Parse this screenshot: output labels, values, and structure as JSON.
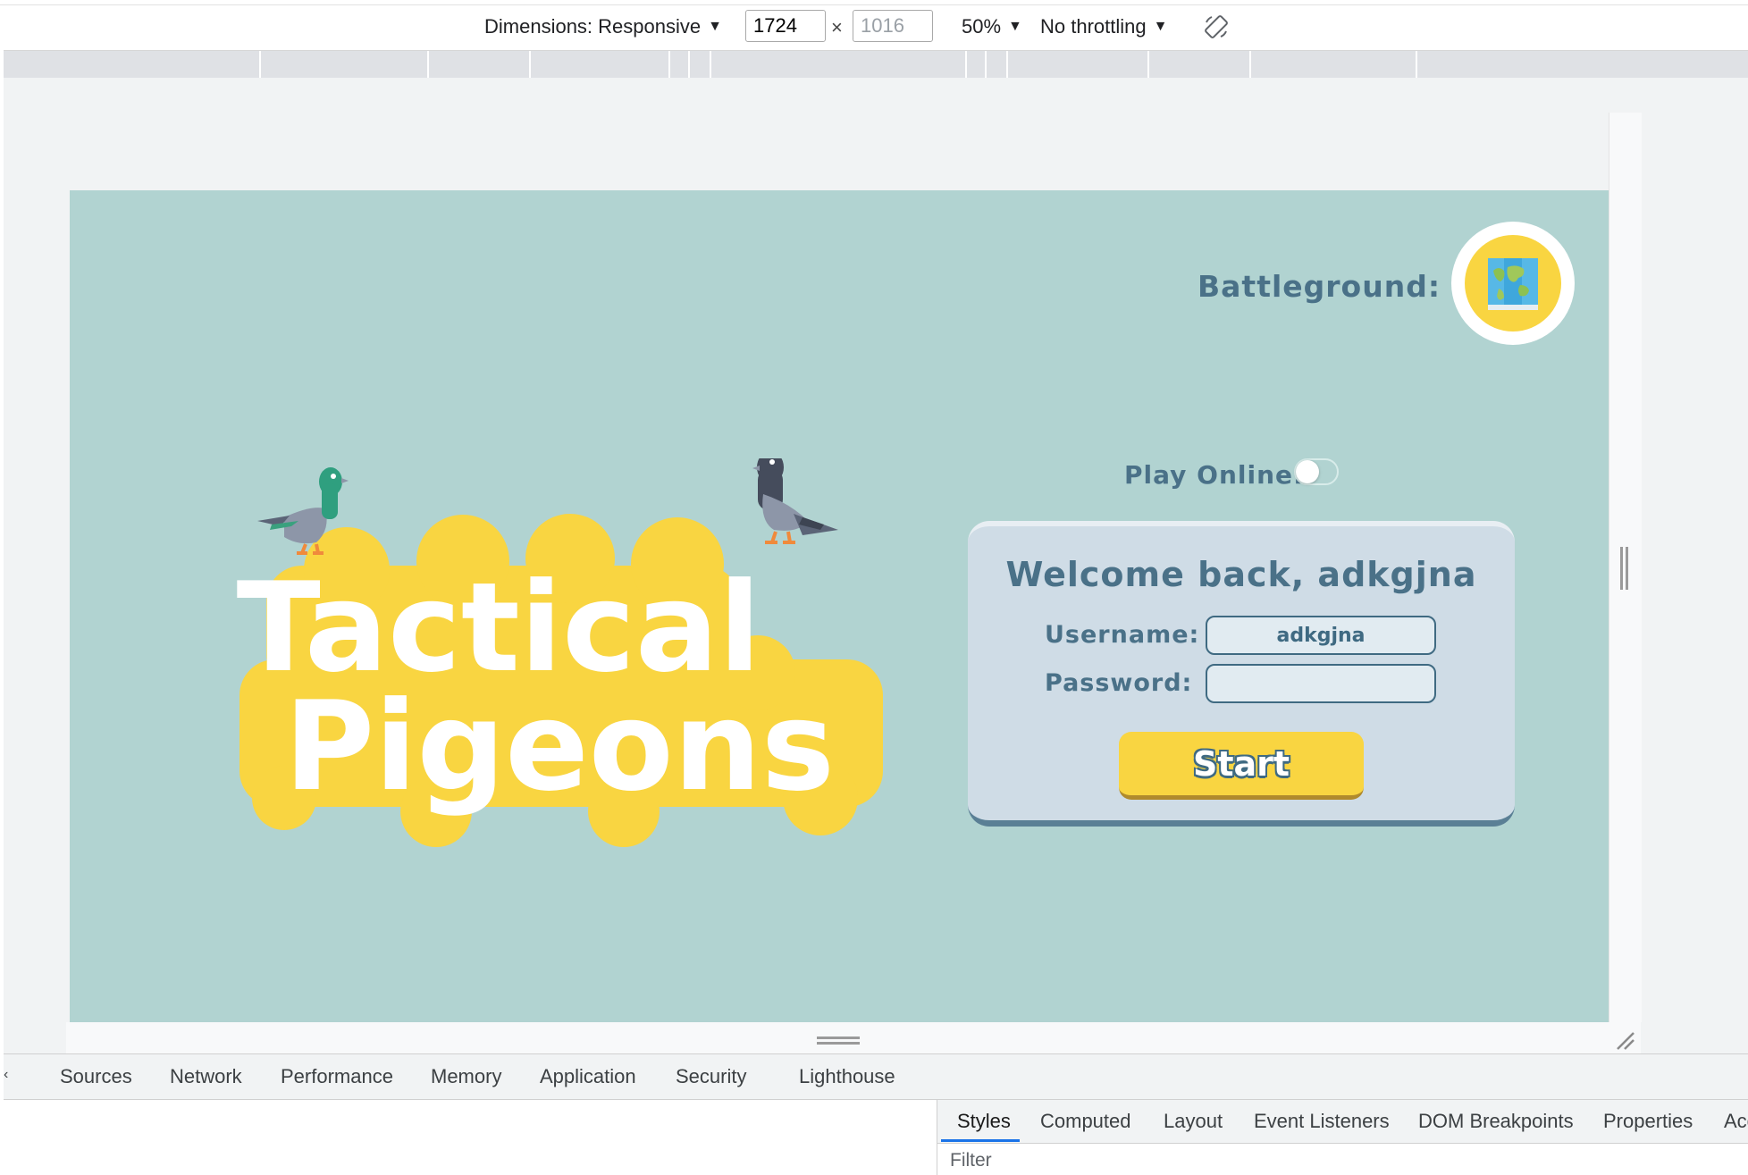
{
  "device_toolbar": {
    "dimensions_label": "Dimensions: Responsive",
    "width_value": "1724",
    "height_value": "1016",
    "times": "×",
    "zoom": "50%",
    "throttling": "No throttling",
    "caret": "▼"
  },
  "game": {
    "battleground_label": "Battleground:",
    "play_online_label": "Play Online:",
    "play_online_enabled": false,
    "logo_line1": "Tactical",
    "logo_line2": "Pigeons",
    "login": {
      "welcome": "Welcome back, adkgjna",
      "username_label": "Username:",
      "username_value": "adkgjna",
      "password_label": "Password:",
      "password_value": "",
      "start_label": "Start"
    },
    "colors": {
      "background": "#b1d3d1",
      "accent_yellow": "#f9d541",
      "text_blue": "#4a7188"
    }
  },
  "devtools": {
    "tabs": [
      "Sources",
      "Network",
      "Performance",
      "Memory",
      "Application",
      "Security",
      "Lighthouse"
    ],
    "side_tabs": [
      "Styles",
      "Computed",
      "Layout",
      "Event Listeners",
      "DOM Breakpoints",
      "Properties",
      "Acc"
    ],
    "active_side_tab": "Styles",
    "filter_label": "Filter"
  }
}
